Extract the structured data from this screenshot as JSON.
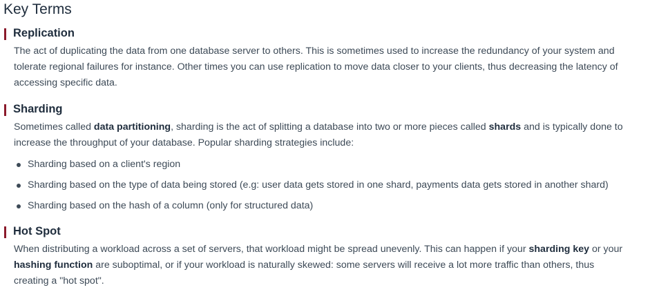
{
  "heading": "Key Terms",
  "replication": {
    "title": "Replication",
    "lines": [
      "The act of duplicating the data from one database server to others. This is sometimes used to increase the redundancy of your system and",
      "tolerate regional failures for instance. Other times you can use replication to move data closer to your clients, thus decreasing the latency of",
      "accessing specific data."
    ]
  },
  "sharding": {
    "title": "Sharding",
    "line1_a": "Sometimes called ",
    "line1_b": "data partitioning",
    "line1_c": ", sharding is the act of splitting a database into two or more pieces called ",
    "line1_d": "shards",
    "line1_e": " and is typically done to",
    "line2": "increase the throughput of your database. Popular sharding strategies include:",
    "bullets": [
      "Sharding based on a client's region",
      "Sharding based on the type of data being stored (e.g: user data gets stored in one shard, payments data gets stored in another shard)",
      "Sharding based on the hash of a column (only for structured data)"
    ]
  },
  "hotspot": {
    "title": "Hot Spot",
    "line1_a": "When distributing a workload across a set of servers, that workload might be spread unevenly. This can happen if your ",
    "line1_b": "sharding key",
    "line1_c": " or your",
    "line2_a": "hashing function",
    "line2_b": " are suboptimal, or if your workload is naturally skewed: some servers will receive a lot more traffic than others, thus",
    "line3": "creating a \"hot spot\"."
  }
}
